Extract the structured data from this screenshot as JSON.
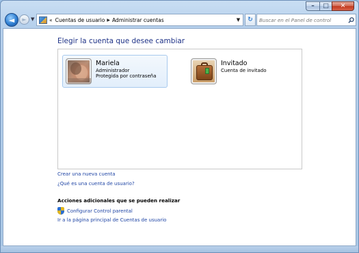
{
  "window": {
    "caption": {
      "minimize": "–",
      "maximize": "□",
      "close": "✕"
    }
  },
  "toolbar": {
    "back_glyph": "◄",
    "forward_glyph": "►",
    "dropdown_glyph": "▼",
    "breadcrumb": {
      "overflow": "«",
      "items": [
        "Cuentas de usuario",
        "Administrar cuentas"
      ],
      "separator": "▶"
    },
    "address_dropdown_glyph": "▼",
    "refresh_glyph": "↻",
    "search": {
      "placeholder": "Buscar en el Panel de control",
      "value": ""
    },
    "search_icon": "search-icon"
  },
  "main": {
    "title": "Elegir la cuenta que desee cambiar",
    "accounts": [
      {
        "name": "Mariela",
        "lines": [
          "Administrador",
          "Protegida por contraseña"
        ],
        "selected": true,
        "icon": "user-photo"
      },
      {
        "name": "Invitado",
        "lines": [
          "Cuenta de invitado"
        ],
        "selected": false,
        "icon": "suitcase-icon"
      }
    ],
    "links": {
      "create_account": "Crear una nueva cuenta",
      "what_is_account": "¿Qué es una cuenta de usuario?"
    },
    "additional": {
      "title": "Acciones adicionales que se pueden realizar",
      "parental_control": "Configurar Control parental",
      "main_page": "Ir a la página principal de Cuentas de usuario"
    }
  },
  "colors": {
    "title": "#1e3287",
    "link": "#1f45a5",
    "selected_border": "#a7c9ee"
  }
}
